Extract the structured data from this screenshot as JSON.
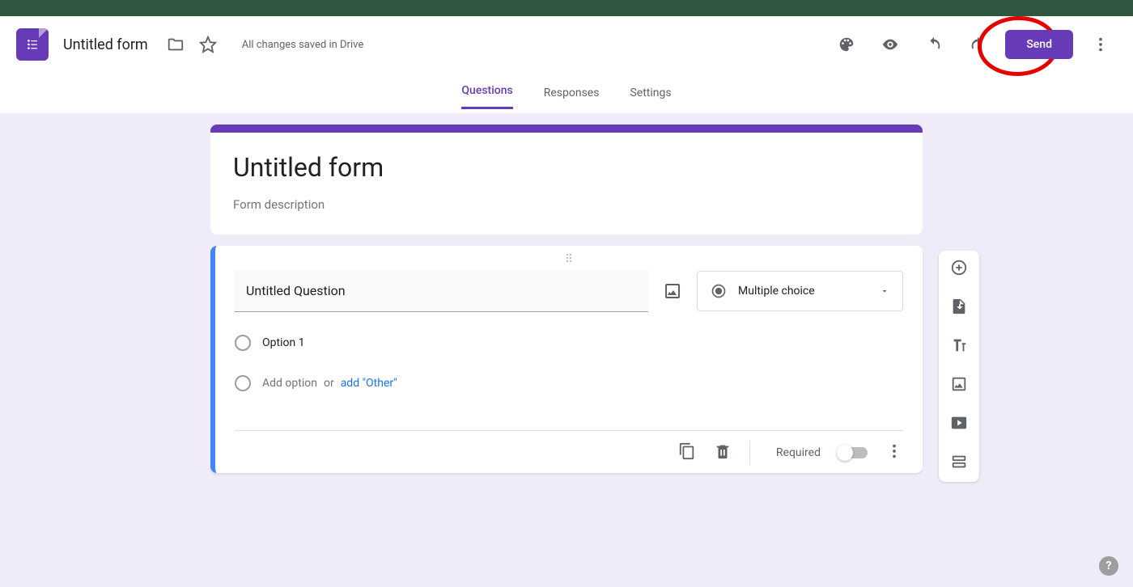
{
  "header": {
    "doc_title": "Untitled form",
    "saved_text": "All changes saved in Drive",
    "send_label": "Send"
  },
  "tabs": {
    "questions": "Questions",
    "responses": "Responses",
    "settings": "Settings",
    "active": "questions"
  },
  "form": {
    "title": "Untitled form",
    "description_placeholder": "Form description"
  },
  "question": {
    "title": "Untitled Question",
    "type_label": "Multiple choice",
    "option1": "Option 1",
    "add_option_text": "Add option",
    "or_text": "or",
    "add_other_text": "add \"Other\"",
    "required_label": "Required"
  },
  "sidebar_icons": {
    "add_question": "add-question",
    "import_questions": "import-questions",
    "add_title": "add-title",
    "add_image": "add-image",
    "add_video": "add-video",
    "add_section": "add-section"
  },
  "help_glyph": "?"
}
